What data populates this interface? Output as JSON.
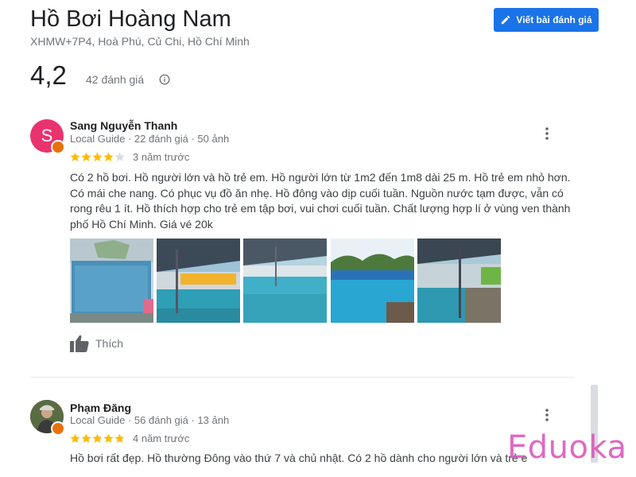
{
  "place": {
    "title": "Hồ Bơi Hoàng Nam",
    "address": "XHMW+7P4, Hoà Phú, Củ Chi, Hồ Chí Minh",
    "rating": "4,2",
    "review_count": "42 đánh giá",
    "write_review_label": "Viết bài đánh giá"
  },
  "reviews": [
    {
      "avatar_letter": "S",
      "name": "Sang Nguyễn Thanh",
      "meta": "Local Guide · 22 đánh giá · 50 ảnh",
      "stars": 4,
      "time": "3 năm trước",
      "text": "Có 2 hồ bơi. Hồ người lớn và hồ trẻ em. Hồ người lớn từ 1m2 đến 1m8 dài 25 m. Hồ trẻ em nhỏ hơn. Có mái che nang. Có phục vụ đồ ăn nhẹ. Hồ đông vào dịp cuối tuần. Nguồn nước tạm được, vẫn có rong rêu 1 ít. Hồ thích hợp cho trẻ em tập bơi, vui chơi cuối tuần. Chất lượng hợp lí ở vùng ven thành phố Hồ Chí Minh. Giá vé 20k",
      "like_label": "Thích",
      "photo_count": 5
    },
    {
      "name": "Phạm Đăng",
      "meta": "Local Guide · 56 đánh giá · 13 ảnh",
      "stars": 5,
      "time": "4 năm trước",
      "text": "Hồ bơi rất đẹp.  Hồ thường Đông vào thứ 7 và chủ nhật.  Có 2 hồ dành cho người lớn và trẻ e"
    }
  ],
  "watermark": "Eduoka",
  "colors": {
    "primary_blue": "#1a73e8",
    "star_gold": "#fbbc04",
    "avatar_pink": "#e8336e",
    "local_guide_orange": "#e8710a",
    "watermark_pink": "#d94fb8"
  },
  "icons": {
    "write_review": "pencil-icon",
    "info": "info-icon",
    "more": "more-vert-icon",
    "like": "thumbs-up-icon",
    "star": "star-icon"
  }
}
